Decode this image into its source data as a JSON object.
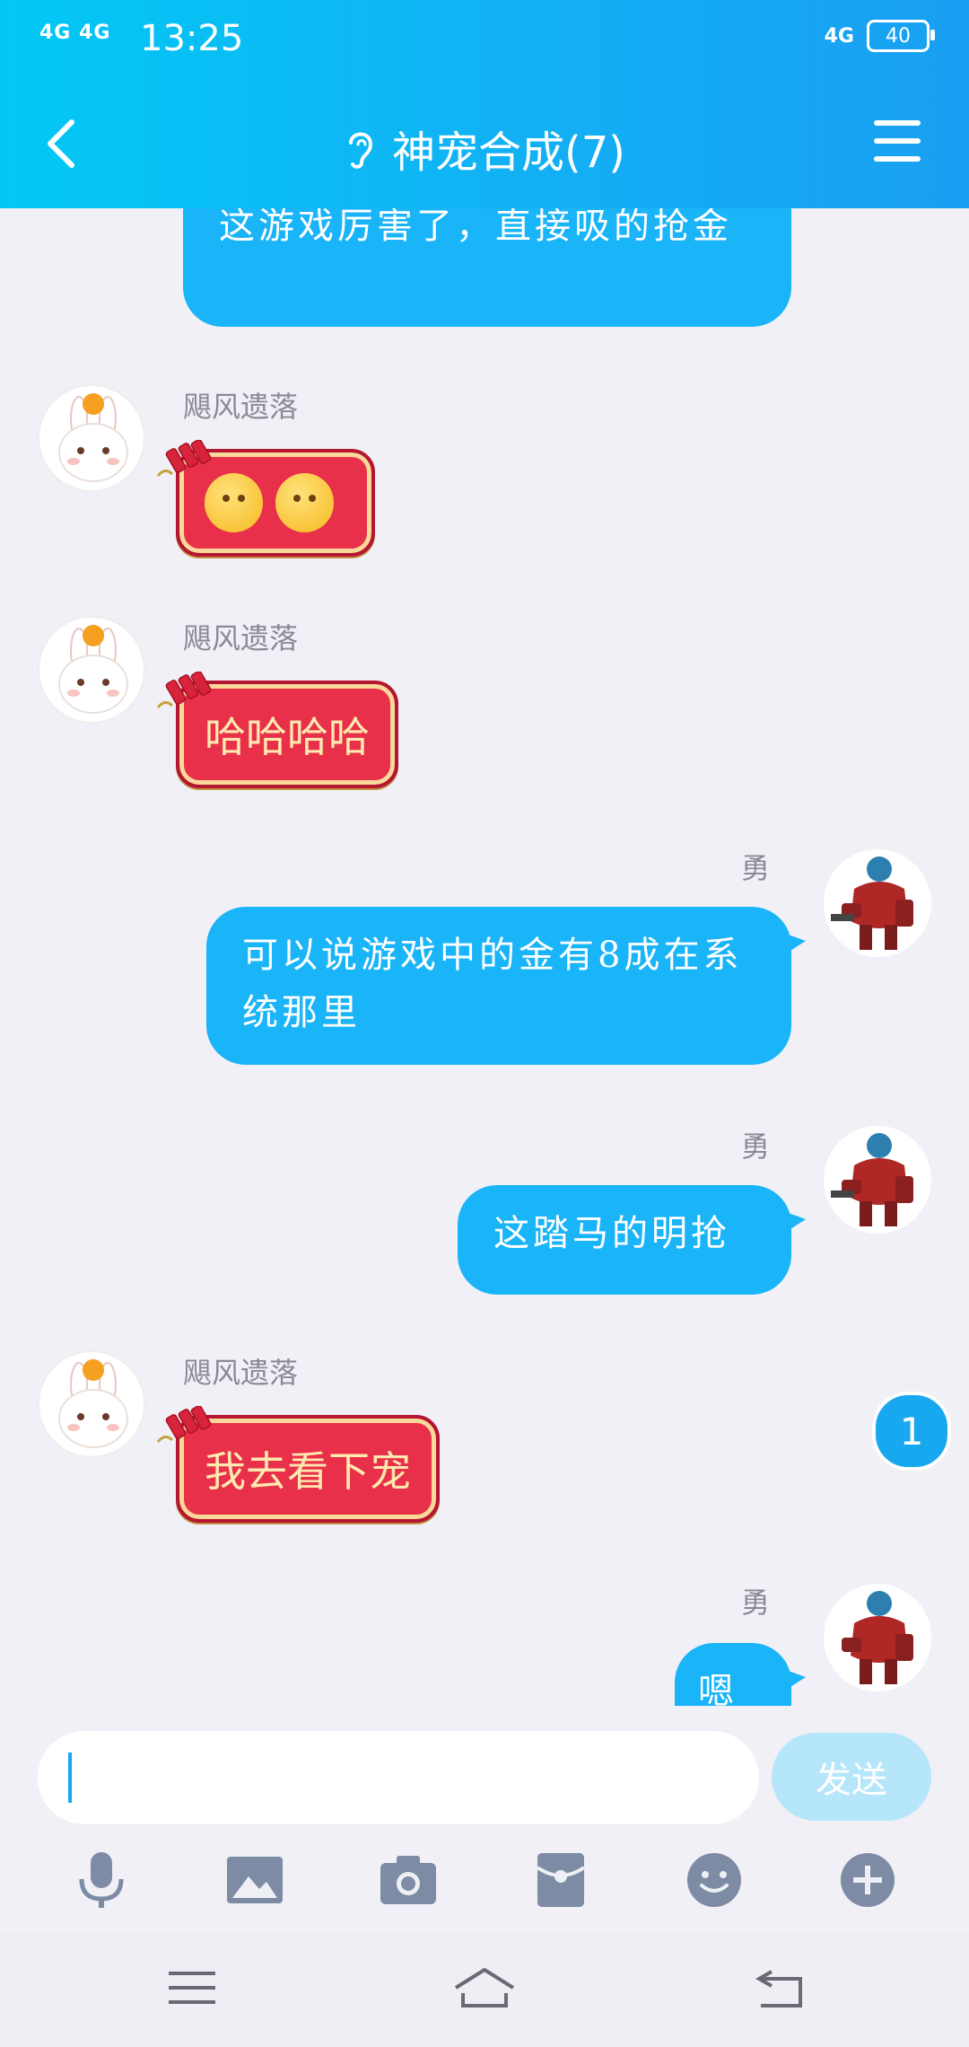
{
  "status": {
    "signal": "4G 4G",
    "time": "13:25",
    "network": "4G",
    "battery": "40"
  },
  "header": {
    "title": "神宠合成(7)"
  },
  "messages": [
    {
      "side": "right",
      "text": "这游戏厉害了，直接吸的抢金"
    },
    {
      "side": "left",
      "sender": "飓风遗落",
      "text": ""
    },
    {
      "side": "left",
      "sender": "飓风遗落",
      "text": "哈哈哈哈"
    },
    {
      "side": "right",
      "sender": "勇",
      "text": "可以说游戏中的金有8成在系统那里"
    },
    {
      "side": "right",
      "sender": "勇",
      "text": "这踏马的明抢"
    },
    {
      "side": "left",
      "sender": "飓风遗落",
      "text": "我去看下宠"
    },
    {
      "side": "right",
      "sender": "勇",
      "text": "嗯"
    }
  ],
  "unread_badge": "1",
  "composer": {
    "placeholder": "",
    "send_label": "发送"
  },
  "toolbar_icons": [
    "microphone-icon",
    "image-icon",
    "camera-icon",
    "red-packet-icon",
    "emoji-icon",
    "plus-icon"
  ],
  "colors": {
    "accent": "#1ab4f8",
    "header_start": "#03c8f5",
    "header_end": "#1a9ff2",
    "red_bubble": "#e8304a"
  }
}
